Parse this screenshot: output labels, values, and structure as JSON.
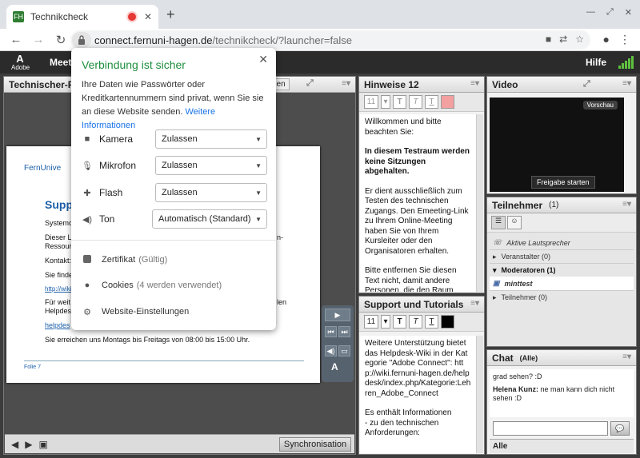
{
  "browser": {
    "tab_title": "Technikcheck",
    "favicon_text": "FH",
    "url_host": "connect.fernuni-hagen.de",
    "url_path": "/technikcheck/?launcher=false"
  },
  "connect": {
    "logo_text": "Adobe",
    "menu_meeting": "Meeti",
    "menu_help": "Hilfe",
    "signal_level": 4
  },
  "share_pod": {
    "title": "Technischer-Pr",
    "hidden_btn": "den",
    "sync_label": "Synchronisation"
  },
  "slide": {
    "logo": "FernUnive",
    "heading": "Suppo",
    "lines": [
      "Systemo",
      "Dieser L",
      "Ressour",
      "Kontakt:",
      "Sie finde",
      "http://wiki.",
      "Für weit",
      "Helpdes",
      "helpdes"
    ],
    "tail_a": "n-",
    "tail_b": "len",
    "hours": "Sie erreichen uns Montags bis Freitags von 08:00 bis 15:00 Uhr.",
    "page": "Folie 7"
  },
  "hinweise": {
    "title": "Hinweise 12",
    "font_size": "11",
    "p1": "Willkommen und bitte beachten Sie:",
    "p2": "In diesem Testraum werden keine Sitzungen abgehalten.",
    "p3": "Er dient ausschließlich zum Testen des technischen Zugangs. Den Emeeting-Link zu Ihrem Online-Meeting haben Sie von Ihrem Kursleiter oder den Organisatoren erhalten.",
    "p4": "Bitte entfernen Sie diesen Text nicht, damit andere Personen, die den Raum nach Ihnen"
  },
  "support": {
    "title": "Support und Tutorials",
    "font_size": "11",
    "p1": "Weitere Unterstützung bietet das Helpdesk-Wiki in der Kategorie \"Adobe Connect\": http://wiki.fernuni-hagen.de/helpdesk/index.php/Kategorie:Lehren_Adobe_Connect",
    "p2": "Es enthält Informationen",
    "p3": "- zu den technischen Anforderungen:"
  },
  "video": {
    "title": "Video",
    "preview": "Vorschau",
    "start_share": "Freigabe starten"
  },
  "attendees": {
    "title": "Teilnehmer",
    "count": "(1)",
    "active_speaker": "Aktive Lautsprecher",
    "hosts": "Veranstalter (0)",
    "presenters": "Moderatoren (1)",
    "presenter_name": "minttest",
    "participants": "Teilnehmer (0)"
  },
  "chat": {
    "title": "Chat",
    "scope": "(Alle)",
    "msg1": "grad sehen? :D",
    "msg2_author": "Helena Kunz:",
    "msg2_text": "ne man kann dich nicht sehen :D",
    "footer": "Alle"
  },
  "popup": {
    "title": "Verbindung ist sicher",
    "desc": "Ihre Daten wie Passwörter oder Kreditkartennummern sind privat, wenn Sie sie an diese Website senden.",
    "more_link": "Weitere Informationen",
    "permissions": [
      {
        "label": "Kamera",
        "value": "Zulassen",
        "icon": "camera-icon"
      },
      {
        "label": "Mikrofon",
        "value": "Zulassen",
        "icon": "microphone-icon"
      },
      {
        "label": "Flash",
        "value": "Zulassen",
        "icon": "puzzle-icon"
      },
      {
        "label": "Ton",
        "value": "Automatisch (Standard)",
        "icon": "speaker-icon"
      }
    ],
    "cert_label": "Zertifikat",
    "cert_status": "(Gültig)",
    "cookies_label": "Cookies",
    "cookies_status": "(4 werden verwendet)",
    "settings_label": "Website-Einstellungen"
  },
  "colors": {
    "secure_green": "#1e8e3e",
    "link_blue": "#1a73e8",
    "brand_blue": "#1b5fa8"
  }
}
